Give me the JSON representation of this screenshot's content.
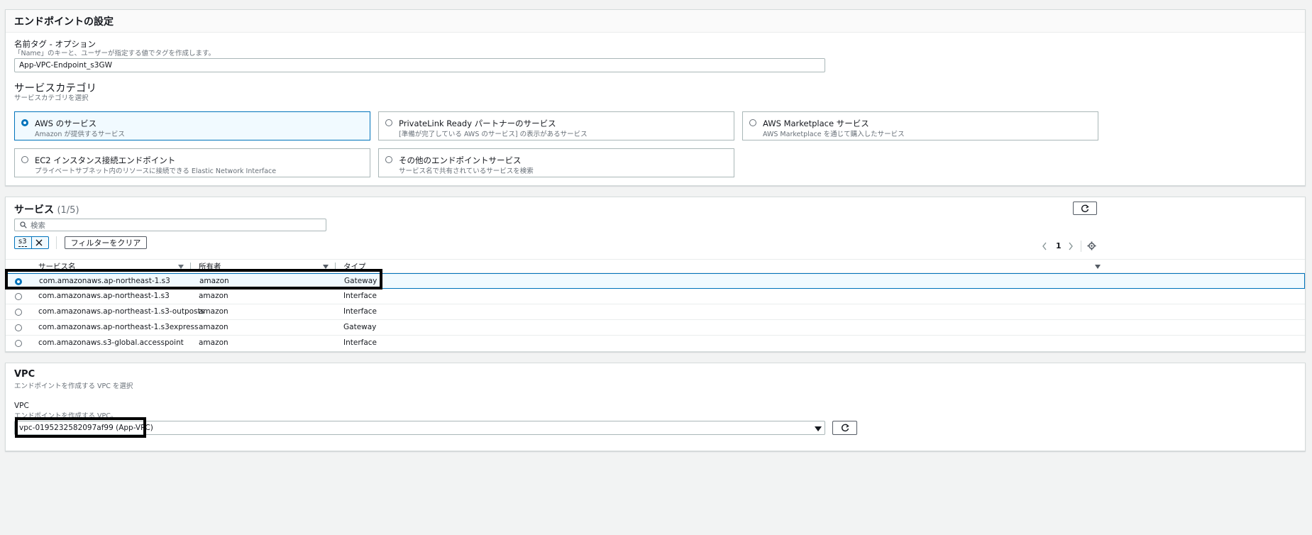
{
  "endpoint_settings": {
    "title": "エンドポイントの設定",
    "name_tag": {
      "label": "名前タグ - オプション",
      "description": "「Name」のキーと、ユーザーが指定する値でタグを作成します。",
      "value": "App-VPC-Endpoint_s3GW"
    },
    "service_category": {
      "title": "サービスカテゴリ",
      "description": "サービスカテゴリを選択",
      "options": [
        {
          "title": "AWS のサービス",
          "desc": "Amazon が提供するサービス",
          "selected": true
        },
        {
          "title": "PrivateLink Ready パートナーのサービス",
          "desc": "[準備が完了している AWS のサービス] の表示があるサービス",
          "selected": false
        },
        {
          "title": "AWS Marketplace サービス",
          "desc": "AWS Marketplace を通じて購入したサービス",
          "selected": false
        },
        {
          "title": "EC2 インスタンス接続エンドポイント",
          "desc": "プライベートサブネット内のリソースに接続できる Elastic Network Interface",
          "selected": false
        },
        {
          "title": "その他のエンドポイントサービス",
          "desc": "サービス名で共有されているサービスを検索",
          "selected": false
        }
      ]
    }
  },
  "services": {
    "title": "サービス",
    "count": "(1/5)",
    "search_placeholder": "検索",
    "filter_token": "s3",
    "clear_filter_label": "フィルターをクリア",
    "page_number": "1",
    "columns": [
      "サービス名",
      "所有者",
      "タイプ"
    ],
    "rows": [
      {
        "name": "com.amazonaws.ap-northeast-1.s3",
        "owner": "amazon",
        "type": "Gateway",
        "selected": true
      },
      {
        "name": "com.amazonaws.ap-northeast-1.s3",
        "owner": "amazon",
        "type": "Interface",
        "selected": false
      },
      {
        "name": "com.amazonaws.ap-northeast-1.s3-outposts",
        "owner": "amazon",
        "type": "Interface",
        "selected": false
      },
      {
        "name": "com.amazonaws.ap-northeast-1.s3express",
        "owner": "amazon",
        "type": "Gateway",
        "selected": false
      },
      {
        "name": "com.amazonaws.s3-global.accesspoint",
        "owner": "amazon",
        "type": "Interface",
        "selected": false
      }
    ]
  },
  "vpc": {
    "title": "VPC",
    "description": "エンドポイントを作成する VPC を選択",
    "field_label": "VPC",
    "field_description": "エンドポイントを作成する VPC。",
    "selected_value": "vpc-0195232582097af99 (App-VPC)"
  },
  "icons": {
    "search": "search-icon",
    "close": "close-icon",
    "refresh": "refresh-icon",
    "settings": "gear-icon",
    "prev": "chevron-left-icon",
    "next": "chevron-right-icon",
    "dropdown": "caret-down-icon",
    "sort": "sort-icon"
  },
  "colors": {
    "accent": "#0073bb",
    "selected_bg": "#f1faff",
    "annotation_box": "#000000"
  }
}
